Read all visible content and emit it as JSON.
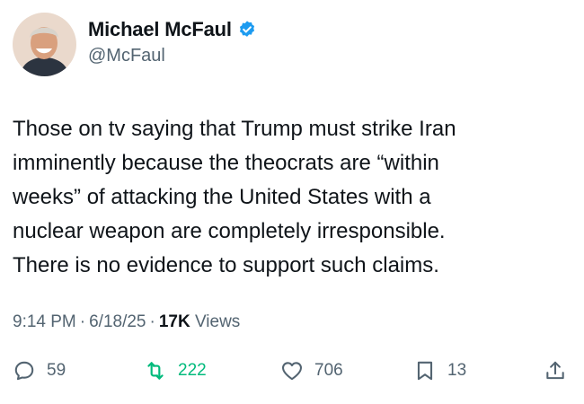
{
  "author": {
    "name": "Michael McFaul",
    "handle": "@McFaul",
    "verified": true
  },
  "tweet": {
    "text": "Those on tv saying that Trump must strike Iran\nimminently because the theocrats are “within\nweeks” of attacking the United States with a\nnuclear weapon are completely irresponsible.\nThere is no evidence to support such claims."
  },
  "meta": {
    "time": "9:14 PM",
    "separator": "·",
    "date": "6/18/25",
    "views_count": "17K",
    "views_label": "Views"
  },
  "actions": {
    "reply": {
      "icon": "reply-icon",
      "count": "59"
    },
    "retweet": {
      "icon": "retweet-icon",
      "count": "222",
      "active_color": "#00ba7c"
    },
    "like": {
      "icon": "heart-icon",
      "count": "706"
    },
    "bookmark": {
      "icon": "bookmark-icon",
      "count": "13"
    },
    "share": {
      "icon": "share-icon"
    }
  },
  "colors": {
    "text_primary": "#0f1419",
    "text_secondary": "#536471",
    "verified_blue": "#1d9bf0",
    "retweet_green": "#00ba7c"
  }
}
